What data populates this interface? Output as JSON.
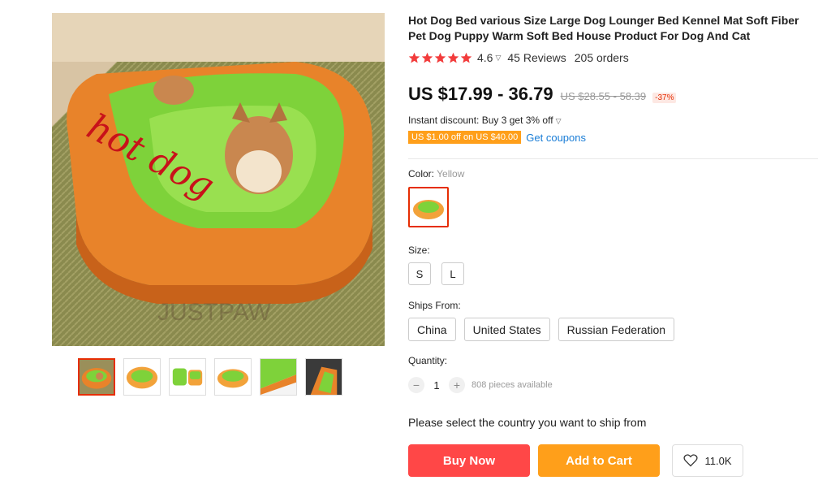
{
  "product": {
    "title": "Hot Dog Bed various Size Large Dog Lounger Bed Kennel Mat Soft Fiber Pet Dog Puppy Warm Soft Bed House Product For Dog And Cat",
    "rating": "4.6",
    "rating_value": 4.6,
    "reviews": "45 Reviews",
    "orders": "205 orders"
  },
  "gallery": {
    "main_image_icon": "hotdog-bed-photo",
    "watermark": "JUSTPAW",
    "bun_text": "hot dog",
    "thumbnails": [
      "hotdog-bed-dog",
      "hotdog-bed-top",
      "hotdog-bed-parts",
      "hotdog-bed-plain",
      "hotdog-bed-detail",
      "hotdog-bed-closeup"
    ]
  },
  "price": {
    "current": "US $17.99 - 36.79",
    "original": "US $28.55 - 58.39",
    "discount": "-37%"
  },
  "promo": {
    "instant": "Instant discount: Buy 3 get 3% off",
    "coupon": "US $1.00 off on US $40.00",
    "get_coupons": "Get coupons"
  },
  "options": {
    "color_label": "Color:",
    "color_value": "Yellow",
    "size_label": "Size:",
    "sizes": [
      "S",
      "L"
    ],
    "ships_label": "Ships From:",
    "ships": [
      "China",
      "United States",
      "Russian Federation"
    ]
  },
  "quantity": {
    "label": "Quantity:",
    "value": "1",
    "minus": "−",
    "plus": "+",
    "available": "808 pieces available"
  },
  "ship_note": "Please select the country you want to ship from",
  "actions": {
    "buy": "Buy Now",
    "cart": "Add to Cart",
    "wishlist_count": "11.0K"
  },
  "colors": {
    "accent_red": "#ff4747",
    "accent_orange": "#ff9f1a",
    "star_red": "#f23c3c",
    "link_blue": "#1a7dd6"
  }
}
